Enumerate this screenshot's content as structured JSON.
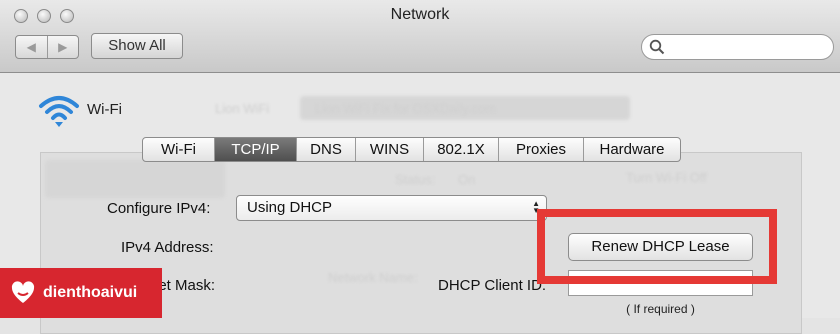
{
  "window": {
    "title": "Network"
  },
  "toolbar": {
    "back_icon": "chevron-left-icon",
    "forward_icon": "chevron-right-icon",
    "back_glyph": "◀",
    "forward_glyph": "▶",
    "show_all_label": "Show All",
    "search_placeholder": ""
  },
  "interface": {
    "icon": "wifi-icon",
    "name": "Wi-Fi"
  },
  "tabs": [
    {
      "label": "Wi-Fi",
      "active": false
    },
    {
      "label": "TCP/IP",
      "active": true
    },
    {
      "label": "DNS",
      "active": false
    },
    {
      "label": "WINS",
      "active": false
    },
    {
      "label": "802.1X",
      "active": false
    },
    {
      "label": "Proxies",
      "active": false
    },
    {
      "label": "Hardware",
      "active": false
    }
  ],
  "form": {
    "configure_ipv4_label": "Configure IPv4:",
    "configure_ipv4_value": "Using DHCP",
    "ipv4_address_label": "IPv4 Address:",
    "subnet_mask_label": "net Mask:",
    "renew_button_label": "Renew DHCP Lease",
    "dhcp_client_id_label": "DHCP Client ID:",
    "dhcp_client_id_value": "",
    "if_required_hint": "( If required )"
  },
  "background_ghost": {
    "location": "Lion WiFi",
    "location_value": "Lion WiFi Fix for OSXDaily.com",
    "status": "Status:",
    "status_value": "On",
    "turn_off": "Turn Wi-Fi Off",
    "network_name": "Network Name:"
  },
  "watermark": {
    "brand": "dienthoaivui"
  },
  "colors": {
    "highlight": "#e53935",
    "brand": "#d7262f",
    "active_tab": "#5a5a5a"
  }
}
